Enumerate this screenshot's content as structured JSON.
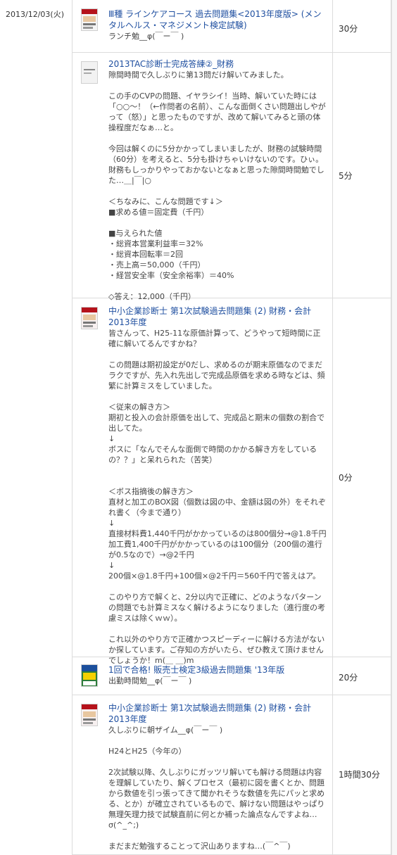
{
  "date": "2013/12/03(火)",
  "entries": [
    {
      "title": "Ⅲ種 ラインケアコース 過去問題集<2013年度版> (メンタルヘルス・マネジメント検定試験)",
      "memo": [
        "ランチ勉__φ(￣ー￣ )"
      ],
      "time": "30分"
    },
    {
      "title": "2013TAC診断士完成答練②_財務",
      "memo": [
        "隙間時間で久しぶりに第13問だけ解いてみました。",
        "",
        "この手のCVPの問題、イヤラシイ！当時、解いていた時には「○○～！（←作問者の名前）、こんな面倒くさい問題出しやがって（怒）」と思ったものですが、改めて解いてみると頭の体操程度だなぁ…と。",
        "",
        "今回は解くのに5分かかってしまいましたが、財務の試験時間（60分）を考えると、5分も掛けちゃいけないのです。ひぃ。財務もしっかりやっておかないとなぁと思った隙間時間勉でした…＿|￣|○",
        "",
        "＜ちなみに、こんな問題です↓＞",
        "■求める値＝固定費（千円）",
        "",
        "■与えられた値",
        "・総資本営業利益率＝32%",
        "・総資本回転率＝2回",
        "・売上高＝50,000（千円）",
        "・経営安全率（安全余裕率）＝40%",
        "",
        "◇答え：12,000（千円）"
      ],
      "time": "5分"
    },
    {
      "title": "中小企業診断士 第1次試験過去問題集 (2) 財務・会計 2013年度",
      "memo": [
        "皆さんって、H25-11な原価計算って、どうやって短時間に正確に解いてるんですかね？",
        "",
        "この問題は期初設定が0だし、求めるのが期末原価なのでまだラクですが、先入れ先出しで完成品原価を求める時などは、頻繁に計算ミスをしていました。",
        "",
        "＜従来の解き方＞",
        "期初と投入の会計原価を出して、完成品と期末の個数の割合で出してた。",
        "↓",
        "ボスに「なんでそんな面倒で時間のかかる解き方をしているの？？」と呆れられた（苦笑）",
        "",
        "",
        "＜ボス指摘後の解き方＞",
        "直材と加工のBOX図（個数は図の中、金額は図の外）をそれぞれ書く（今まで通り）",
        "↓",
        "直接材料費1,440千円がかかっているのは800個分→@1.8千円",
        "加工費1,400千円がかかっているのは100個分（200個の進行が0.5なので）→@2千円",
        "↓",
        "200個×@1.8千円+100個×@2千円＝560千円で答えはア。",
        "",
        "このやり方で解くと、2分以内で正確に、どのようなパターンの問題でも計算ミスなく解けるようになりました（進行度の考慮ミスは除くｗｗ）。",
        "",
        "これ以外のやり方で正確かつスピーディーに解ける方法がないか探しています。ご存知の方がいたら、ぜひ教えて頂けませんでしょうか！m(＿ ＿)m"
      ],
      "time": "0分"
    },
    {
      "title": "1回で合格! 販売士検定3級過去問題集 '13年版",
      "memo": [
        "出勤時間勉__φ(￣ー￣ )"
      ],
      "time": "20分"
    },
    {
      "title": "中小企業診断士 第1次試験過去問題集 (2) 財務・会計 2013年度",
      "memo": [
        "久しぶりに朝ザイム__φ(￣ー￣ )",
        "",
        "H24とH25（今年の）",
        "",
        "2次試験以降、久しぶりにガッツリ解いても解ける問題は内容を理解していたり、解くプロセス（最初に図を書くとか、問題から数値を引っ張ってきて聞かれそうな数値を先にパッと求める、とか）が確立されているもので、解けない問題はやっぱり無理矢理力技で試験直前に何とか補った論点なんですよね…σ(^_^;)",
        "",
        "まだまだ勉強することって沢山ありますね…(￣^￣)"
      ],
      "time": "1時間30分"
    }
  ]
}
